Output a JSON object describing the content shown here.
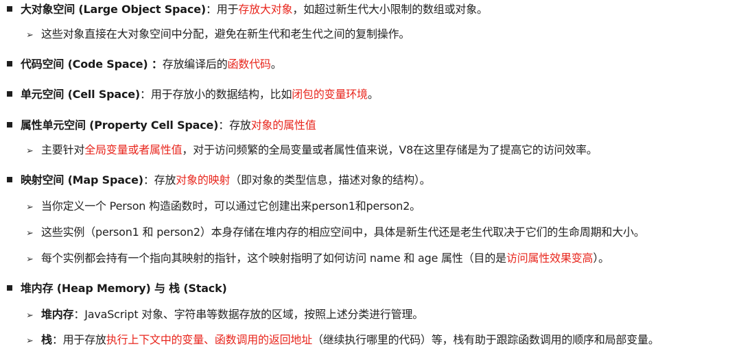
{
  "colors": {
    "text": "#222222",
    "highlight": "#e8261d",
    "background": "#ffffff"
  },
  "icons": {
    "level1": "black-square-bullet",
    "level2": "arrowhead-bullet"
  },
  "lines": [
    {
      "level": 1,
      "segments": [
        {
          "t": "大对象空间 (Large Object Space)",
          "s": "bold"
        },
        {
          "t": "：用于",
          "s": "normal"
        },
        {
          "t": "存放大对象",
          "s": "red"
        },
        {
          "t": "，如超过新生代大小限制的数组或对象。",
          "s": "normal"
        }
      ]
    },
    {
      "level": 2,
      "segments": [
        {
          "t": "这些对象直接在大对象空间中分配，避免在新生代和老生代之间的复制操作。",
          "s": "normal"
        }
      ]
    },
    {
      "level": 1,
      "segments": [
        {
          "t": "代码空间 (Code Space) ：",
          "s": "bold"
        },
        {
          "t": "存放编译后的",
          "s": "normal"
        },
        {
          "t": "函数代码",
          "s": "red"
        },
        {
          "t": "。",
          "s": "normal"
        }
      ]
    },
    {
      "level": 1,
      "segments": [
        {
          "t": "单元空间 (Cell Space)",
          "s": "bold"
        },
        {
          "t": "：用于存放小的数据结构，比如",
          "s": "normal"
        },
        {
          "t": "闭包的变量环境",
          "s": "red"
        },
        {
          "t": "。",
          "s": "normal"
        }
      ]
    },
    {
      "level": 1,
      "segments": [
        {
          "t": "属性单元空间 (Property Cell Space)",
          "s": "bold"
        },
        {
          "t": "：存放",
          "s": "normal"
        },
        {
          "t": "对象的属性值",
          "s": "red"
        }
      ]
    },
    {
      "level": 2,
      "segments": [
        {
          "t": "主要针对",
          "s": "normal"
        },
        {
          "t": "全局变量或者属性值",
          "s": "red"
        },
        {
          "t": "，对于访问频繁的全局变量或者属性值来说，V8在这里存储是为了提高它的访问效率。",
          "s": "normal"
        }
      ]
    },
    {
      "level": 1,
      "segments": [
        {
          "t": "映射空间 (Map Space)",
          "s": "bold"
        },
        {
          "t": "：存放",
          "s": "normal"
        },
        {
          "t": "对象的映射",
          "s": "red"
        },
        {
          "t": "（即对象的类型信息，描述对象的结构）。",
          "s": "normal"
        }
      ]
    },
    {
      "level": 2,
      "segments": [
        {
          "t": "当你定义一个 Person 构造函数时，可以通过它创建出来person1和person2。",
          "s": "normal"
        }
      ]
    },
    {
      "level": 2,
      "segments": [
        {
          "t": "这些实例（person1 和 person2）本身存储在堆内存的相应空间中，具体是新生代还是老生代取决于它们的生命周期和大小。",
          "s": "normal"
        }
      ]
    },
    {
      "level": 2,
      "segments": [
        {
          "t": "每个实例都会持有一个指向其映射的指针，这个映射指明了如何访问 name 和 age 属性（目的是",
          "s": "normal"
        },
        {
          "t": "访问属性效果变高",
          "s": "red"
        },
        {
          "t": "）。",
          "s": "normal"
        }
      ]
    },
    {
      "level": 1,
      "segments": [
        {
          "t": "堆内存 (Heap Memory) 与 栈 (Stack)",
          "s": "bold"
        }
      ]
    },
    {
      "level": 2,
      "segments": [
        {
          "t": "堆内存",
          "s": "bold"
        },
        {
          "t": "：JavaScript 对象、字符串等数据存放的区域，按照上述分类进行管理。",
          "s": "normal"
        }
      ]
    },
    {
      "level": 2,
      "segments": [
        {
          "t": "栈",
          "s": "bold"
        },
        {
          "t": "：用于存放",
          "s": "normal"
        },
        {
          "t": "执行上下文中的变量、函数调用的返回地址",
          "s": "red"
        },
        {
          "t": "（继续执行哪里的代码）等，栈有助于跟踪函数调用的顺序和局部变量。",
          "s": "normal"
        }
      ]
    }
  ]
}
